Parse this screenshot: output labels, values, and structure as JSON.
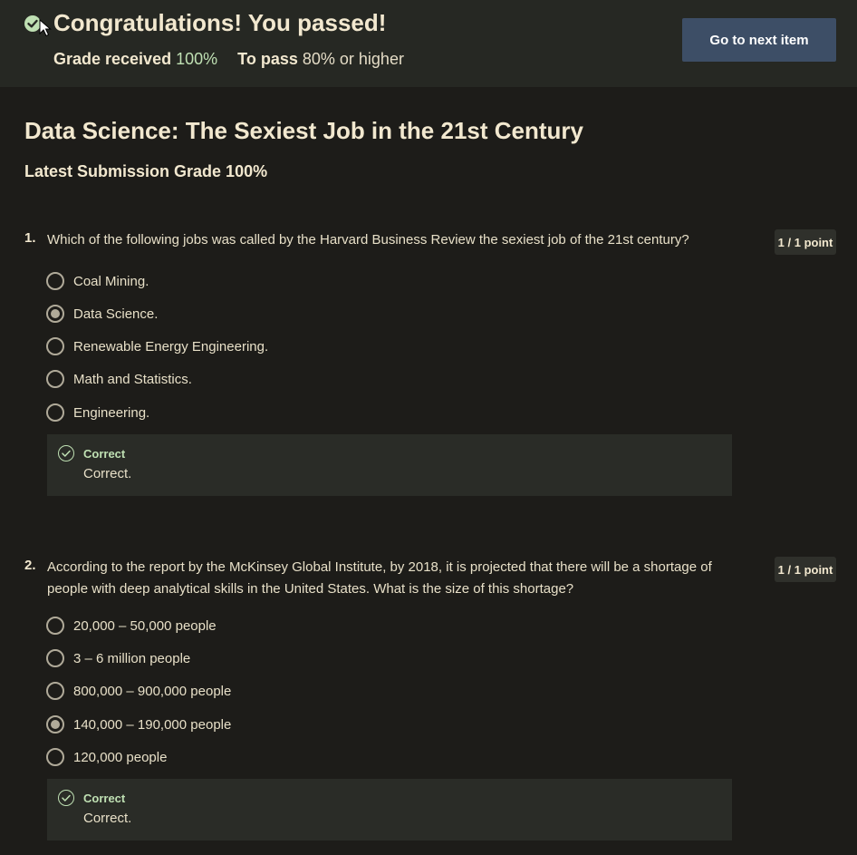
{
  "banner": {
    "title": "Congratulations! You passed!",
    "grade_label": "Grade received",
    "grade_value": "100%",
    "pass_label": "To pass",
    "pass_value": "80% or higher",
    "next_button": "Go to next item",
    "icon": "check-circle-icon"
  },
  "quiz": {
    "title": "Data Science: The Sexiest Job in the 21st Century",
    "latest_grade": "Latest Submission Grade 100%"
  },
  "questions": [
    {
      "number": "1.",
      "text": "Which of the following jobs was called by the Harvard Business Review the sexiest job of the 21st century?",
      "points": "1 / 1 point",
      "options": [
        {
          "label": "Coal Mining.",
          "selected": false
        },
        {
          "label": "Data Science.",
          "selected": true
        },
        {
          "label": "Renewable Energy Engineering.",
          "selected": false
        },
        {
          "label": "Math and Statistics.",
          "selected": false
        },
        {
          "label": "Engineering.",
          "selected": false
        }
      ],
      "feedback": {
        "title": "Correct",
        "text": "Correct."
      }
    },
    {
      "number": "2.",
      "text": "According to the report by the McKinsey Global Institute, by 2018, it is projected that there will be a shortage of people with deep analytical skills in the United States. What is the size of this shortage?",
      "points": "1 / 1 point",
      "options": [
        {
          "label": "20,000 – 50,000 people",
          "selected": false
        },
        {
          "label": "3 – 6 million people",
          "selected": false
        },
        {
          "label": "800,000 – 900,000 people",
          "selected": false
        },
        {
          "label": "140,000 – 190,000 people",
          "selected": true
        },
        {
          "label": "120,000 people",
          "selected": false
        }
      ],
      "feedback": {
        "title": "Correct",
        "text": "Correct."
      }
    }
  ],
  "colors": {
    "background": "#1d1c19",
    "banner": "#262823",
    "button": "#3d4e66",
    "success": "#bfe0b3"
  }
}
